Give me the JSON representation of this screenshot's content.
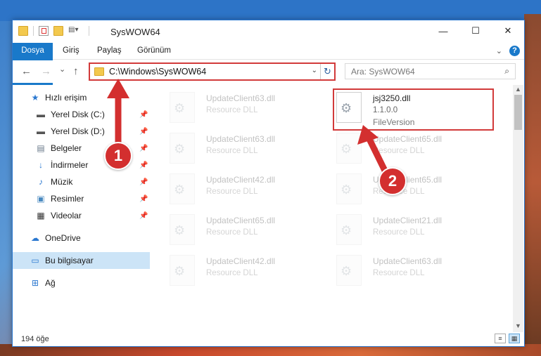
{
  "window": {
    "title": "SysWOW64",
    "controls": {
      "minimize": "—",
      "maximize": "☐",
      "close": "✕"
    }
  },
  "ribbon": {
    "tabs": [
      "Dosya",
      "Giriş",
      "Paylaş",
      "Görünüm"
    ],
    "expand_icon": "chevron-down-icon",
    "help": "?"
  },
  "navigation": {
    "back": "←",
    "forward": "→",
    "recent": "⌄",
    "up": "↑",
    "address": "C:\\Windows\\SysWOW64",
    "address_dropdown": "⌄",
    "refresh": "↻",
    "search_placeholder": "Ara: SysWOW64",
    "search_icon": "⌕"
  },
  "sidebar": {
    "items": [
      {
        "label": "Hızlı erişim",
        "icon": "star-icon",
        "glyph": "★",
        "pinned": false
      },
      {
        "label": "Yerel Disk (C:)",
        "icon": "drive-icon",
        "glyph": "▬",
        "pinned": true
      },
      {
        "label": "Yerel Disk (D:)",
        "icon": "drive-icon",
        "glyph": "▬",
        "pinned": true
      },
      {
        "label": "Belgeler",
        "icon": "document-icon",
        "glyph": "▤",
        "pinned": true
      },
      {
        "label": "İndirmeler",
        "icon": "download-icon",
        "glyph": "↓",
        "pinned": true
      },
      {
        "label": "Müzik",
        "icon": "music-icon",
        "glyph": "♪",
        "pinned": true
      },
      {
        "label": "Resimler",
        "icon": "image-icon",
        "glyph": "▣",
        "pinned": true
      },
      {
        "label": "Videolar",
        "icon": "video-icon",
        "glyph": "▦",
        "pinned": true
      },
      {
        "label": "OneDrive",
        "icon": "cloud-icon",
        "glyph": "☁",
        "pinned": false
      },
      {
        "label": "Bu bilgisayar",
        "icon": "computer-icon",
        "glyph": "▭",
        "pinned": false,
        "selected": true
      },
      {
        "label": "Ağ",
        "icon": "network-icon",
        "glyph": "⊞",
        "pinned": false
      }
    ],
    "pin_glyph": "📌"
  },
  "files": {
    "left_column": [
      {
        "name": "UpdateClient63.dll",
        "desc": "Resource DLL"
      },
      {
        "name": "UpdateClient63.dll",
        "desc": "Resource DLL"
      },
      {
        "name": "UpdateClient42.dll",
        "desc": "Resource DLL"
      },
      {
        "name": "UpdateClient65.dll",
        "desc": "Resource DLL"
      },
      {
        "name": "UpdateClient42.dll",
        "desc": "Resource DLL"
      }
    ],
    "right_column": [
      {
        "name": "jsj3250.dll",
        "desc": "1.1.0.0",
        "sub": "FileVersion",
        "highlighted": true
      },
      {
        "name": "UpdateClient65.dll",
        "desc": "Resource DLL"
      },
      {
        "name": "UpdateClient65.dll",
        "desc": "Resource DLL"
      },
      {
        "name": "UpdateClient21.dll",
        "desc": "Resource DLL"
      },
      {
        "name": "UpdateClient63.dll",
        "desc": "Resource DLL"
      }
    ]
  },
  "status": {
    "item_count": "194 öğe"
  },
  "annotations": {
    "step1": "1",
    "step2": "2",
    "color": "#d32f2f"
  }
}
